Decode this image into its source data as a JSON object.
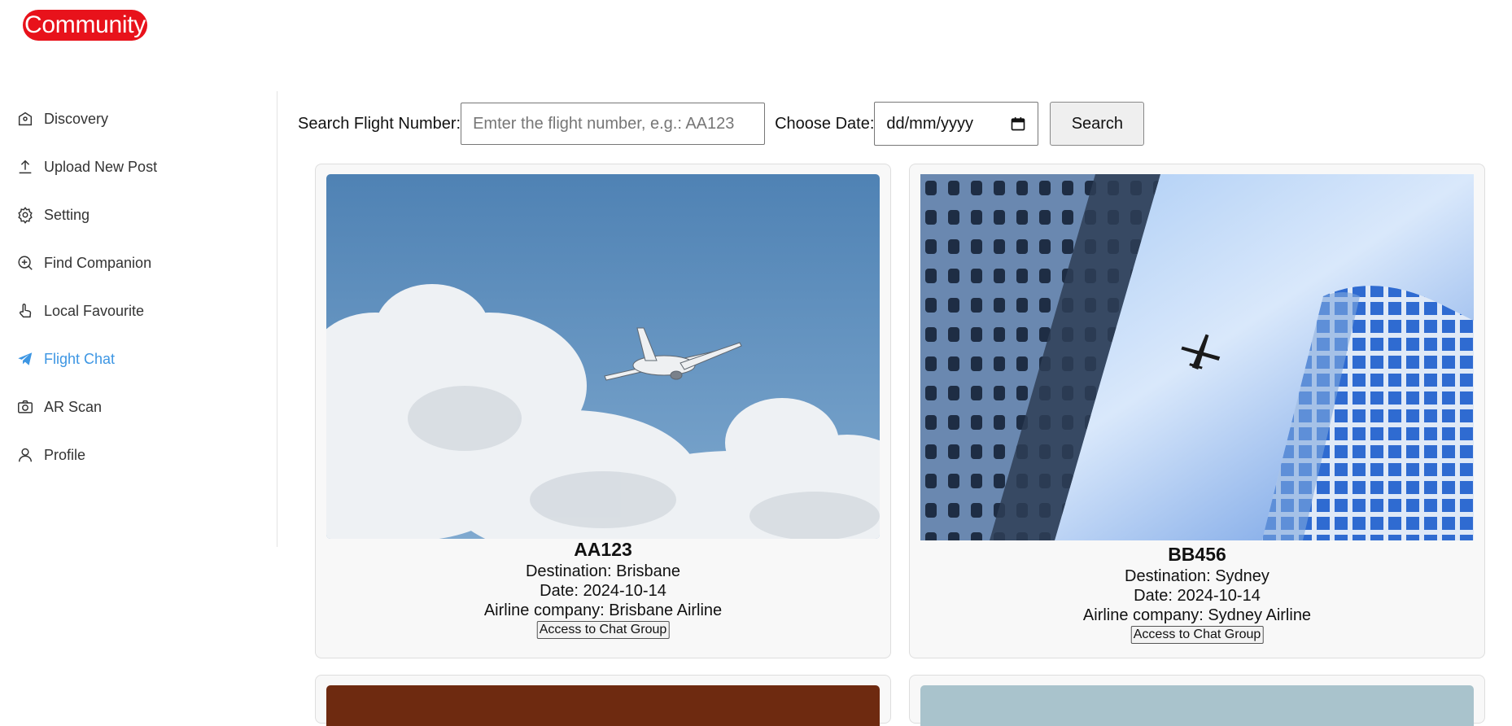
{
  "app": {
    "logo": "Community"
  },
  "sidebar": {
    "items": [
      {
        "label": "Discovery",
        "icon": "home-icon",
        "active": false
      },
      {
        "label": "Upload New Post",
        "icon": "upload-icon",
        "active": false
      },
      {
        "label": "Setting",
        "icon": "gear-icon",
        "active": false
      },
      {
        "label": "Find Companion",
        "icon": "search-plus-icon",
        "active": false
      },
      {
        "label": "Local Favourite",
        "icon": "hand-pointer-icon",
        "active": false
      },
      {
        "label": "Flight Chat",
        "icon": "paper-plane-icon",
        "active": true
      },
      {
        "label": "AR Scan",
        "icon": "camera-icon",
        "active": false
      },
      {
        "label": "Profile",
        "icon": "user-icon",
        "active": false
      }
    ],
    "active_color": "#3d96e3"
  },
  "search": {
    "flight_label": "Search Flight Number:",
    "flight_placeholder": "Emter the flight number, e.g.: AA123",
    "date_label": "Choose Date:",
    "date_value": "dd/mm/yyyy",
    "button_label": "Search"
  },
  "flights": [
    {
      "number": "AA123",
      "destination": "Destination: Brisbane",
      "date": "Date: 2024-10-14",
      "airline": "Airline company: Brisbane Airline",
      "button": "Access to Chat Group",
      "image": "airplane-in-clouds"
    },
    {
      "number": "BB456",
      "destination": "Destination: Sydney",
      "date": "Date: 2024-10-14",
      "airline": "Airline company: Sydney Airline",
      "button": "Access to Chat Group",
      "image": "airplane-between-skyscrapers"
    }
  ],
  "colors": {
    "logo_bg": "#e8121b"
  }
}
